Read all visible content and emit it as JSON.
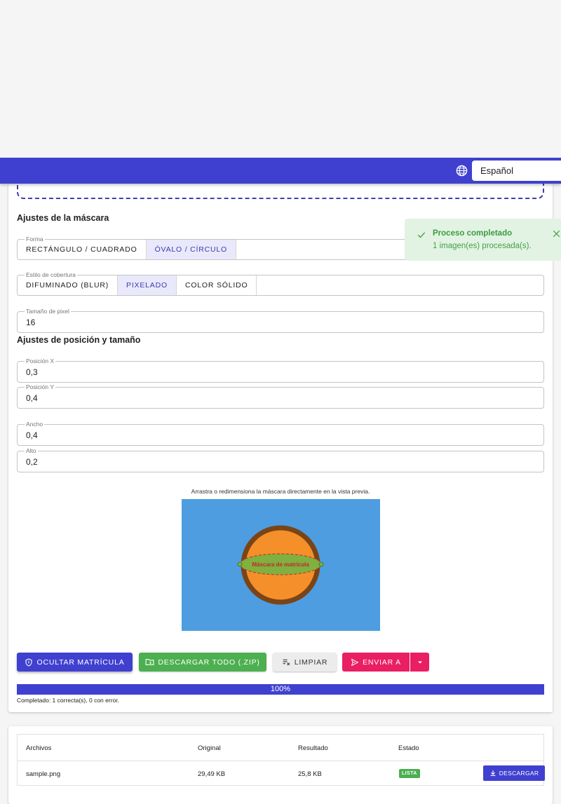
{
  "header": {
    "language": "Español"
  },
  "mask_settings": {
    "title": "Ajustes de la máscara",
    "shape": {
      "legend": "Forma",
      "options": [
        "RECTÁNGULO / CUADRADO",
        "ÓVALO / CÍRCULO"
      ],
      "selected": 1
    },
    "coverage": {
      "legend": "Estilo de cobertura",
      "options": [
        "DIFUMINADO (BLUR)",
        "PIXELADO",
        "COLOR SÓLIDO"
      ],
      "selected": 1
    },
    "pixel_size": {
      "label": "Tamaño de pixel",
      "value": "16"
    }
  },
  "position_settings": {
    "title": "Ajustes de posición y tamaño",
    "x": {
      "label": "Posición X",
      "value": "0,3"
    },
    "y": {
      "label": "Posición Y",
      "value": "0,4"
    },
    "width": {
      "label": "Ancho",
      "value": "0,4"
    },
    "height": {
      "label": "Alto",
      "value": "0,2"
    }
  },
  "preview": {
    "hint": "Arrastra o redimensiona la máscara directamente en la vista previa.",
    "mask_label": "Máscara de matrícula"
  },
  "actions": {
    "hide_plate": "OCULTAR MATRÍCULA",
    "download_all": "DESCARGAR TODO (.ZIP)",
    "clear": "LIMPIAR",
    "send_to": "ENVIAR A"
  },
  "progress": {
    "percent": 100,
    "label": "100%",
    "status": "Completado: 1 correcta(s), 0 con error."
  },
  "table": {
    "headers": [
      "Archivos",
      "Original",
      "Resultado",
      "Estado"
    ],
    "rows": [
      {
        "file": "sample.png",
        "original": "29,49 KB",
        "result": "25,8 KB",
        "status": "LISTA",
        "action": "DESCARGAR"
      }
    ]
  },
  "toast": {
    "title": "Proceso completado",
    "message": "1 imagen(es) procesada(s)."
  },
  "colors": {
    "primary": "#4040d0",
    "success": "#4caf50",
    "accent": "#e91e63"
  }
}
